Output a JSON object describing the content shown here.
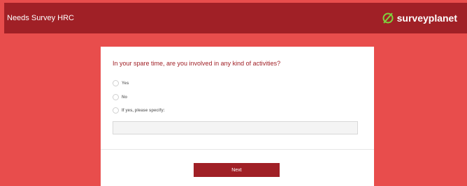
{
  "header": {
    "title": "Needs Survey HRC",
    "brand": "surveyplanet",
    "brand_icon": "surveyplanet-logo-icon",
    "color": "#a02026"
  },
  "page": {
    "background": "#e84d4c"
  },
  "survey": {
    "question": "In your spare time, are you involved in any kind of activities?",
    "options": [
      {
        "label": "Yes",
        "selected": false
      },
      {
        "label": "No",
        "selected": false
      },
      {
        "label": "If yes, please specify:",
        "selected": false
      }
    ],
    "specify_value": "",
    "next_label": "Next"
  }
}
